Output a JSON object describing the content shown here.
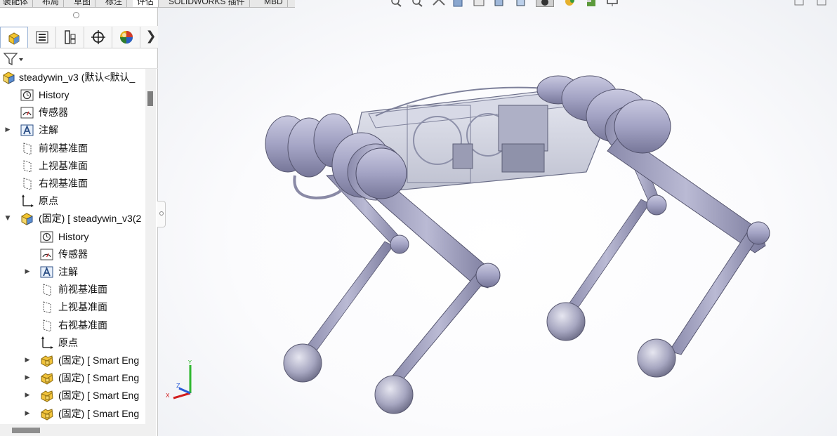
{
  "command_tabs": [
    "装配体",
    "布局",
    "草图",
    "标注",
    "评估",
    "SOLIDWORKS 插件",
    "MBD"
  ],
  "manager_tabs": [
    {
      "icon": "featuremanager-icon"
    },
    {
      "icon": "propertymanager-icon"
    },
    {
      "icon": "configurationmanager-icon"
    },
    {
      "icon": "dimxpertmanager-icon"
    },
    {
      "icon": "displaymanager-icon"
    }
  ],
  "more_tabs_glyph": "❯",
  "tree": {
    "root_label": "steadywin_v3 (默认<默认_",
    "items": [
      {
        "label": "History",
        "icon": "history-icon"
      },
      {
        "label": "传感器",
        "icon": "sensor-icon"
      },
      {
        "label": "注解",
        "icon": "annotation-icon"
      },
      {
        "label": "前视基准面",
        "icon": "plane-icon"
      },
      {
        "label": "上视基准面",
        "icon": "plane-icon"
      },
      {
        "label": "右视基准面",
        "icon": "plane-icon"
      },
      {
        "label": "原点",
        "icon": "origin-icon"
      },
      {
        "label": "(固定) [ steadywin_v3(2",
        "icon": "subassembly-icon"
      },
      {
        "label": "History",
        "icon": "history-icon"
      },
      {
        "label": "传感器",
        "icon": "sensor-icon"
      },
      {
        "label": "注解",
        "icon": "annotation-icon"
      },
      {
        "label": "前视基准面",
        "icon": "plane-icon"
      },
      {
        "label": "上视基准面",
        "icon": "plane-icon"
      },
      {
        "label": "右视基准面",
        "icon": "plane-icon"
      },
      {
        "label": "原点",
        "icon": "origin-icon"
      },
      {
        "label": "(固定) [ Smart Eng",
        "icon": "part-icon"
      },
      {
        "label": "(固定) [ Smart Eng",
        "icon": "part-icon"
      },
      {
        "label": "(固定) [ Smart Eng",
        "icon": "part-icon"
      },
      {
        "label": "(固定) [ Smart Eng",
        "icon": "part-icon"
      }
    ]
  },
  "triad": {
    "x": "X",
    "y": "Y",
    "z": "Z"
  },
  "colors": {
    "model": "#a9a9c9",
    "model_dark": "#6f6f92",
    "triad_x": "#d21e1e",
    "triad_y": "#2fb82f",
    "triad_z": "#2a5bd7"
  }
}
